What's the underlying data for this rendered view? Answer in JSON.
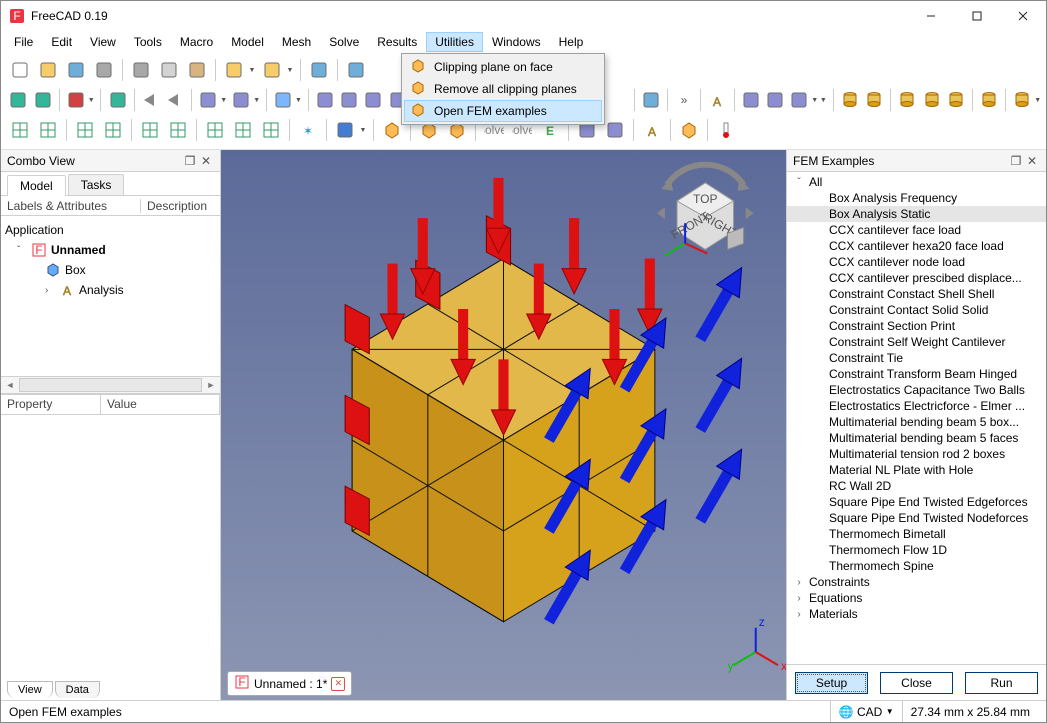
{
  "window": {
    "title": "FreeCAD 0.19"
  },
  "menubar": [
    "File",
    "Edit",
    "View",
    "Tools",
    "Macro",
    "Model",
    "Mesh",
    "Solve",
    "Results",
    "Utilities",
    "Windows",
    "Help"
  ],
  "menubar_open_index": 9,
  "utilities_menu": [
    {
      "label": "Clipping plane on face",
      "icon": "cube-clip-icon"
    },
    {
      "label": "Remove all clipping planes",
      "icon": "cube-unclip-icon"
    },
    {
      "label": "Open FEM examples",
      "icon": "cube-list-icon",
      "highlight": true
    }
  ],
  "combo_view": {
    "title": "Combo View",
    "tabs": [
      "Model",
      "Tasks"
    ],
    "active_tab": 0,
    "tree_header": [
      "Labels & Attributes",
      "Description"
    ],
    "tree": {
      "root": "Application",
      "doc": "Unnamed",
      "items": [
        {
          "label": "Box",
          "icon": "cube"
        },
        {
          "label": "Analysis",
          "icon": "A",
          "expandable": true
        }
      ]
    },
    "prop_header": [
      "Property",
      "Value"
    ],
    "bottom_tabs": [
      "View",
      "Data"
    ]
  },
  "doc_tab": "Unnamed : 1*",
  "fem_panel": {
    "title": "FEM Examples",
    "groups_top": {
      "label": "All",
      "expanded": true
    },
    "items": [
      "Box Analysis Frequency",
      "Box Analysis Static",
      "CCX cantilever face load",
      "CCX cantilever hexa20 face load",
      "CCX cantilever node load",
      "CCX cantilever prescibed displace...",
      "Constraint Constact Shell Shell",
      "Constraint Contact Solid Solid",
      "Constraint Section Print",
      "Constraint Self Weight Cantilever",
      "Constraint Tie",
      "Constraint Transform Beam Hinged",
      "Electrostatics Capacitance Two Balls",
      "Electrostatics Electricforce - Elmer ...",
      "Multimaterial bending beam 5 box...",
      "Multimaterial bending beam 5 faces",
      "Multimaterial tension rod 2 boxes",
      "Material NL Plate with Hole",
      "RC Wall 2D",
      "Square Pipe End Twisted Edgeforces",
      "Square Pipe End Twisted Nodeforces",
      "Thermomech Bimetall",
      "Thermomech Flow 1D",
      "Thermomech Spine"
    ],
    "selected_index": 1,
    "groups_bottom": [
      "Constraints",
      "Equations",
      "Materials"
    ],
    "buttons": [
      "Setup",
      "Close",
      "Run"
    ]
  },
  "statusbar": {
    "hint": "Open FEM examples",
    "mode": "CAD",
    "coords": "27.34 mm x 25.84 mm"
  },
  "toolbar_rows": [
    [
      "new",
      "open",
      "save",
      "print",
      "|",
      "cut",
      "copy",
      "paste",
      "|",
      "undo",
      "drop",
      "redo",
      "drop",
      "|",
      "refresh",
      "|",
      "whatsthis"
    ],
    [
      "fit-all",
      "fit-sel",
      "|",
      "drawstyle",
      "drop",
      "|",
      "bbox",
      "|",
      "nav-prev",
      "nav-next",
      "|",
      "link1",
      "drop",
      "link2",
      "drop",
      "|",
      "iso",
      "drop",
      "|",
      "front",
      "top",
      "right",
      "rear",
      "bottom",
      "left",
      "|",
      "measure",
      "drop",
      "part",
      "gap",
      "|",
      "folder",
      "|",
      "chevrons",
      "|",
      "A-tool",
      "|",
      "sel1",
      "sel2",
      "wave",
      "drop",
      "drop",
      "|",
      "cyl1",
      "cyl2",
      "|",
      "cyl3",
      "cyl4",
      "cyl5",
      "|",
      "cyl6",
      "|",
      "cyl7",
      "drop"
    ],
    [
      "grid",
      "grid2",
      "|",
      "grid3",
      "grid4",
      "|",
      "grid5",
      "grid6",
      "|",
      "grid7",
      "grid8",
      "grid9",
      "|",
      "snow",
      "|",
      "sphere",
      "drop",
      "|",
      "cube-a",
      "|",
      "cube-b",
      "cube-c",
      "|",
      "solver1",
      "solver2",
      "E",
      "|",
      "meas1",
      "meas2",
      "|",
      "A2",
      "|",
      "cube-d",
      "|",
      "thermo"
    ]
  ]
}
